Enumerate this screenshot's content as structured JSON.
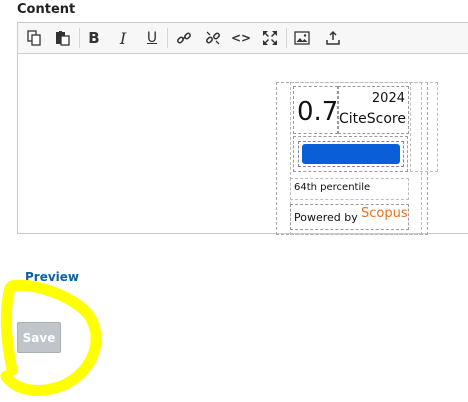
{
  "field": {
    "label": "Content"
  },
  "toolbar": {
    "buttons": [
      {
        "name": "copy",
        "icon": "copy-icon"
      },
      {
        "name": "paste",
        "icon": "paste-icon"
      },
      {
        "name": "bold",
        "icon": "bold-icon",
        "glyph": "B"
      },
      {
        "name": "italic",
        "icon": "italic-icon",
        "glyph": "I"
      },
      {
        "name": "underline",
        "icon": "underline-icon",
        "glyph": "U"
      },
      {
        "name": "link",
        "icon": "link-icon"
      },
      {
        "name": "unlink",
        "icon": "unlink-icon"
      },
      {
        "name": "source",
        "icon": "code-icon",
        "glyph": "<>"
      },
      {
        "name": "maximize",
        "icon": "maximize-icon"
      },
      {
        "name": "image",
        "icon": "image-icon"
      },
      {
        "name": "upload",
        "icon": "upload-icon"
      }
    ]
  },
  "widget": {
    "score": "0.7",
    "year": "2024",
    "metric": "CiteScore",
    "percentile_text": "64th percentile",
    "percentile_value": 64,
    "powered_by": "Powered by",
    "brand": "Scopus",
    "bar_color": "#0a5fd8",
    "brand_color": "#e9711c"
  },
  "actions": {
    "preview_label": "Preview",
    "save_label": "Save"
  },
  "annotation": {
    "color": "#ffff00"
  }
}
